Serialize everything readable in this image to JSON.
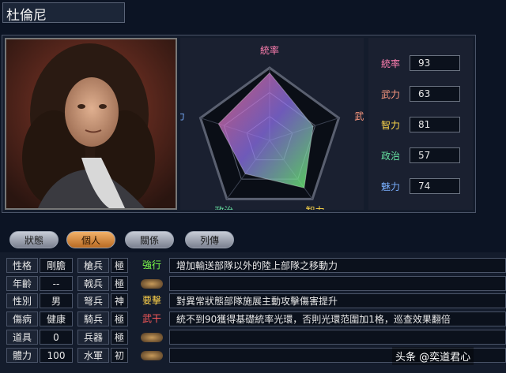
{
  "title": "杜倫尼",
  "radar": {
    "axes": [
      "統率",
      "武力",
      "智力",
      "政治",
      "魅力"
    ],
    "colors": [
      "#ff7fb0",
      "#ff9a80",
      "#ffd84a",
      "#66e0a0",
      "#7ab0ff"
    ],
    "values": [
      93,
      63,
      81,
      57,
      74
    ],
    "max": 100
  },
  "stats": [
    {
      "label": "統率",
      "value": "93",
      "color": "#ff7fb0"
    },
    {
      "label": "武力",
      "value": "63",
      "color": "#ff9a80"
    },
    {
      "label": "智力",
      "value": "81",
      "color": "#ffd84a"
    },
    {
      "label": "政治",
      "value": "57",
      "color": "#66e0a0"
    },
    {
      "label": "魅力",
      "value": "74",
      "color": "#7ab0ff"
    }
  ],
  "tabs": [
    "狀態",
    "個人",
    "關係",
    "列傳"
  ],
  "active_tab": "個人",
  "profile": [
    {
      "label": "性格",
      "value": "剛膽"
    },
    {
      "label": "年齡",
      "value": "--"
    },
    {
      "label": "性別",
      "value": "男"
    },
    {
      "label": "傷病",
      "value": "健康"
    },
    {
      "label": "道具",
      "value": "0"
    },
    {
      "label": "體力",
      "value": "100"
    }
  ],
  "aptitudes": [
    {
      "label": "槍兵",
      "value": "極"
    },
    {
      "label": "戟兵",
      "value": "極"
    },
    {
      "label": "弩兵",
      "value": "神"
    },
    {
      "label": "騎兵",
      "value": "極"
    },
    {
      "label": "兵器",
      "value": "極"
    },
    {
      "label": "水軍",
      "value": "初"
    }
  ],
  "skills": [
    {
      "name": "強行",
      "desc": "增加輸送部隊以外的陸上部隊之移動力",
      "color": "#7dff4a"
    },
    {
      "name": "",
      "desc": ""
    },
    {
      "name": "要擊",
      "desc": "對異常狀態部隊施展主動攻擊傷害提升",
      "color": "#ffd24a"
    },
    {
      "name": "武干",
      "desc": "統不到90獲得基礎統率光環，否則光環范圍加1格，巡查效果翻倍",
      "color": "#ff5a5a"
    },
    {
      "name": "",
      "desc": ""
    },
    {
      "name": "",
      "desc": ""
    }
  ],
  "watermark": "头条 @奕道君心"
}
